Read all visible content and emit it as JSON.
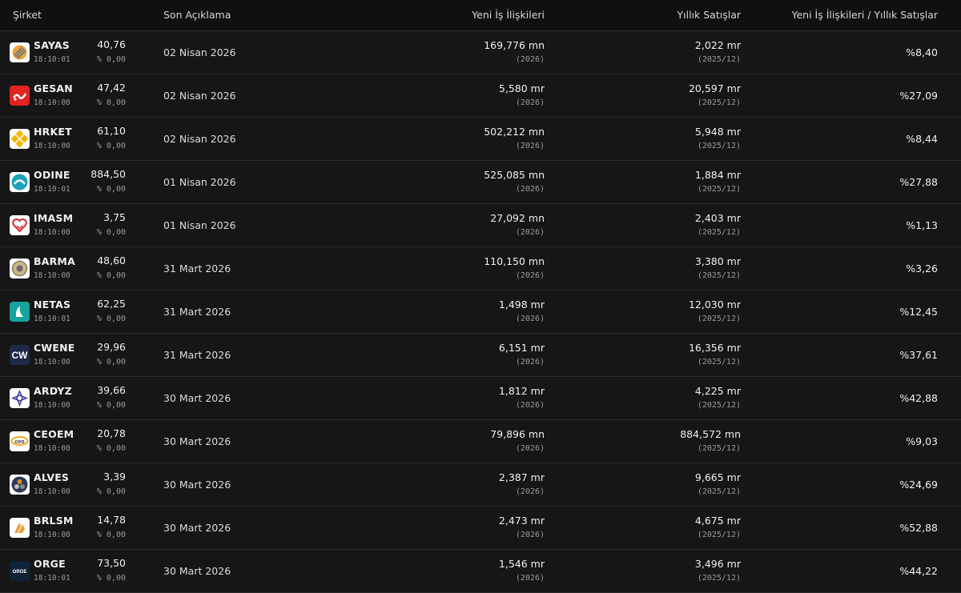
{
  "header": {
    "company": "Şirket",
    "last_disclosure": "Son Açıklama",
    "new_business": "Yeni İş İlişkileri",
    "annual_sales": "Yıllık Satışlar",
    "ratio": "Yeni İş İlişkileri / Yıllık Satışlar"
  },
  "rows": [
    {
      "ticker": "SAYAS",
      "time": "18:10:01",
      "price": "40,76",
      "change": "% 0,00",
      "date": "02 Nisan 2026",
      "new_business": "169,776 mn",
      "new_business_period": "(2026)",
      "annual_sales": "2,022 mr",
      "annual_sales_period": "(2025/12)",
      "ratio": "%8,40",
      "logo_icon": "sayas-logo-icon"
    },
    {
      "ticker": "GESAN",
      "time": "18:10:00",
      "price": "47,42",
      "change": "% 0,00",
      "date": "02 Nisan 2026",
      "new_business": "5,580 mr",
      "new_business_period": "(2026)",
      "annual_sales": "20,597 mr",
      "annual_sales_period": "(2025/12)",
      "ratio": "%27,09",
      "logo_icon": "gesan-logo-icon"
    },
    {
      "ticker": "HRKET",
      "time": "18:10:00",
      "price": "61,10",
      "change": "% 0,00",
      "date": "02 Nisan 2026",
      "new_business": "502,212 mn",
      "new_business_period": "(2026)",
      "annual_sales": "5,948 mr",
      "annual_sales_period": "(2025/12)",
      "ratio": "%8,44",
      "logo_icon": "hrket-logo-icon"
    },
    {
      "ticker": "ODINE",
      "time": "18:10:01",
      "price": "884,50",
      "change": "% 0,00",
      "date": "01 Nisan 2026",
      "new_business": "525,085 mn",
      "new_business_period": "(2026)",
      "annual_sales": "1,884 mr",
      "annual_sales_period": "(2025/12)",
      "ratio": "%27,88",
      "logo_icon": "odine-logo-icon"
    },
    {
      "ticker": "IMASM",
      "time": "18:10:00",
      "price": "3,75",
      "change": "% 0,00",
      "date": "01 Nisan 2026",
      "new_business": "27,092 mn",
      "new_business_period": "(2026)",
      "annual_sales": "2,403 mr",
      "annual_sales_period": "(2025/12)",
      "ratio": "%1,13",
      "logo_icon": "imasm-logo-icon"
    },
    {
      "ticker": "BARMA",
      "time": "18:10:00",
      "price": "48,60",
      "change": "% 0,00",
      "date": "31 Mart 2026",
      "new_business": "110,150 mn",
      "new_business_period": "(2026)",
      "annual_sales": "3,380 mr",
      "annual_sales_period": "(2025/12)",
      "ratio": "%3,26",
      "logo_icon": "barma-logo-icon"
    },
    {
      "ticker": "NETAS",
      "time": "18:10:01",
      "price": "62,25",
      "change": "% 0,00",
      "date": "31 Mart 2026",
      "new_business": "1,498 mr",
      "new_business_period": "(2026)",
      "annual_sales": "12,030 mr",
      "annual_sales_period": "(2025/12)",
      "ratio": "%12,45",
      "logo_icon": "netas-logo-icon"
    },
    {
      "ticker": "CWENE",
      "time": "18:10:00",
      "price": "29,96",
      "change": "% 0,00",
      "date": "31 Mart 2026",
      "new_business": "6,151 mr",
      "new_business_period": "(2026)",
      "annual_sales": "16,356 mr",
      "annual_sales_period": "(2025/12)",
      "ratio": "%37,61",
      "logo_icon": "cwene-logo-icon",
      "logo_text": "CW"
    },
    {
      "ticker": "ARDYZ",
      "time": "18:10:00",
      "price": "39,66",
      "change": "% 0,00",
      "date": "30 Mart 2026",
      "new_business": "1,812 mr",
      "new_business_period": "(2026)",
      "annual_sales": "4,225 mr",
      "annual_sales_period": "(2025/12)",
      "ratio": "%42,88",
      "logo_icon": "ardyz-logo-icon"
    },
    {
      "ticker": "CEOEM",
      "time": "18:10:00",
      "price": "20,78",
      "change": "% 0,00",
      "date": "30 Mart 2026",
      "new_business": "79,896 mn",
      "new_business_period": "(2026)",
      "annual_sales": "884,572 mn",
      "annual_sales_period": "(2025/12)",
      "ratio": "%9,03",
      "logo_icon": "ceoem-logo-icon",
      "logo_text": "ceo"
    },
    {
      "ticker": "ALVES",
      "time": "18:10:00",
      "price": "3,39",
      "change": "% 0,00",
      "date": "30 Mart 2026",
      "new_business": "2,387 mr",
      "new_business_period": "(2026)",
      "annual_sales": "9,665 mr",
      "annual_sales_period": "(2025/12)",
      "ratio": "%24,69",
      "logo_icon": "alves-logo-icon"
    },
    {
      "ticker": "BRLSM",
      "time": "18:10:00",
      "price": "14,78",
      "change": "% 0,00",
      "date": "30 Mart 2026",
      "new_business": "2,473 mr",
      "new_business_period": "(2026)",
      "annual_sales": "4,675 mr",
      "annual_sales_period": "(2025/12)",
      "ratio": "%52,88",
      "logo_icon": "brlsm-logo-icon"
    },
    {
      "ticker": "ORGE",
      "time": "18:10:01",
      "price": "73,50",
      "change": "% 0,00",
      "date": "30 Mart 2026",
      "new_business": "1,546 mr",
      "new_business_period": "(2026)",
      "annual_sales": "3,496 mr",
      "annual_sales_period": "(2025/12)",
      "ratio": "%44,22",
      "logo_icon": "orge-logo-icon",
      "logo_text": "ORGE"
    }
  ]
}
